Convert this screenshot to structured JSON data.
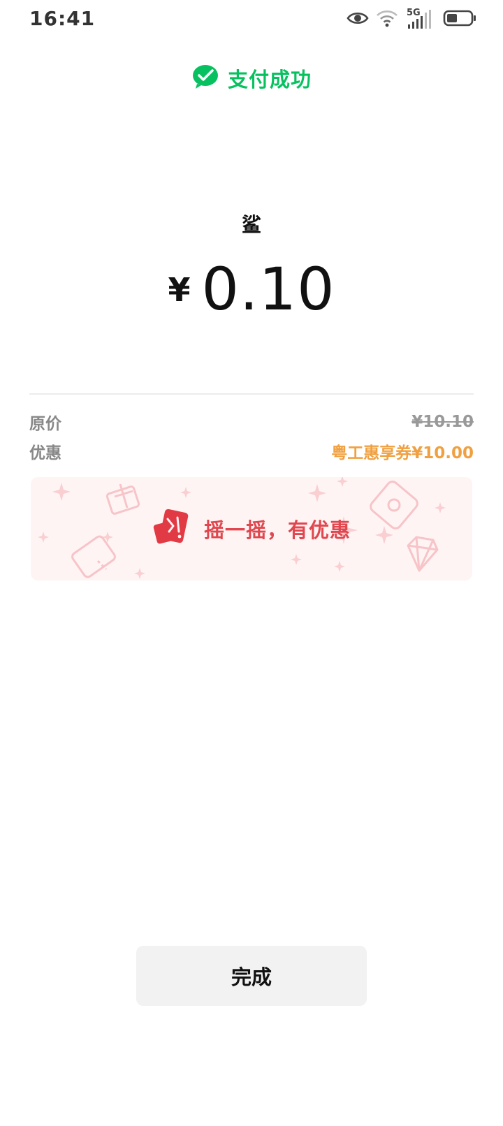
{
  "status_bar": {
    "time": "16:41",
    "network_label": "5G",
    "icons": [
      "eye-icon",
      "wifi-icon",
      "cellular-signal-icon",
      "battery-icon"
    ]
  },
  "header": {
    "title": "支付成功",
    "icon": "wechat-pay-check-icon",
    "accent_color": "#07c160"
  },
  "payment": {
    "merchant": "鲨",
    "currency_symbol": "¥",
    "amount": "0.10"
  },
  "details": {
    "original_label": "原价",
    "original_value": "¥10.10",
    "discount_label": "优惠",
    "discount_value": "粤工惠享券¥10.00",
    "discount_color": "#f0a040"
  },
  "shake_banner": {
    "text": "摇一摇，有优惠",
    "icon": "shake-phone-icon",
    "text_color": "#e0474f"
  },
  "actions": {
    "done_label": "完成"
  }
}
